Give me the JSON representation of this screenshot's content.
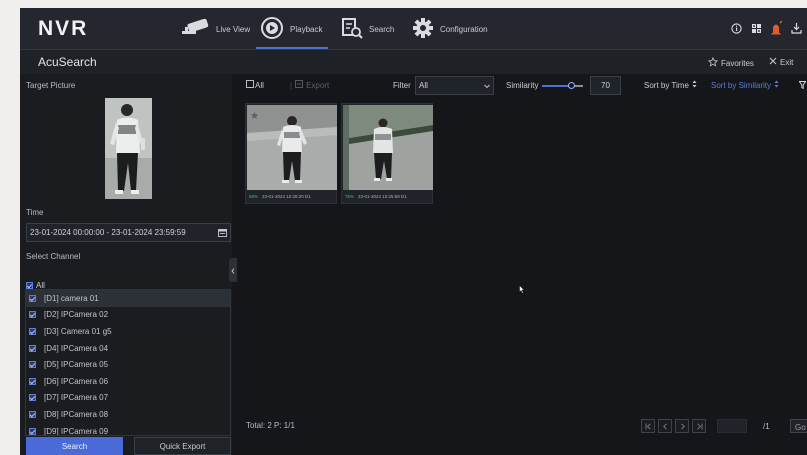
{
  "topbar": {
    "logo": "NVR",
    "nav": [
      {
        "label": "Live View",
        "icon": "camera-icon"
      },
      {
        "label": "Playback",
        "icon": "playback-icon",
        "active": true
      },
      {
        "label": "Search",
        "icon": "search-doc-icon"
      },
      {
        "label": "Configuration",
        "icon": "gear-icon"
      }
    ],
    "right_icons": [
      "info-icon",
      "grid-icon",
      "alarm-icon",
      "download-icon"
    ]
  },
  "page": {
    "title": "AcuSearch",
    "favorites_label": "Favorites",
    "exit_label": "Exit"
  },
  "left": {
    "target_picture_label": "Target Picture",
    "time_label": "Time",
    "time_value": "23-01-2024 00:00:00 - 23-01-2024 23:59:59",
    "select_channel_label": "Select Channel",
    "all_label": "All",
    "channels": [
      "[D1] camera 01",
      "[D2] IPCamera 02",
      "[D3] Camera 01 g5",
      "[D4] IPCamera 04",
      "[D5] IPCamera 05",
      "[D6] IPCamera 06",
      "[D7] IPCamera 07",
      "[D8] IPCamera 08",
      "[D9] IPCamera 09"
    ],
    "search_button": "Search",
    "quick_export_button": "Quick Export"
  },
  "toolbar": {
    "all_label": "All",
    "export_label": "Export",
    "filter_label": "Filter",
    "filter_value": "All",
    "similarity_label": "Similarity",
    "similarity_value": "70",
    "sort_time": "Sort by Time",
    "sort_similarity": "Sort by Similarity"
  },
  "results": [
    {
      "pct": "58%",
      "time": "23-01-2024 10:28:20 D1"
    },
    {
      "pct": "76%",
      "time": "23-01-2024 10:25:59 D1"
    }
  ],
  "footer": {
    "total": "Total: 2  P: 1/1",
    "page_total": "/1",
    "go": "Go"
  },
  "colors": {
    "accent": "#4a6ad8",
    "bg": "#14161a",
    "match_green": "#3ccb52"
  }
}
